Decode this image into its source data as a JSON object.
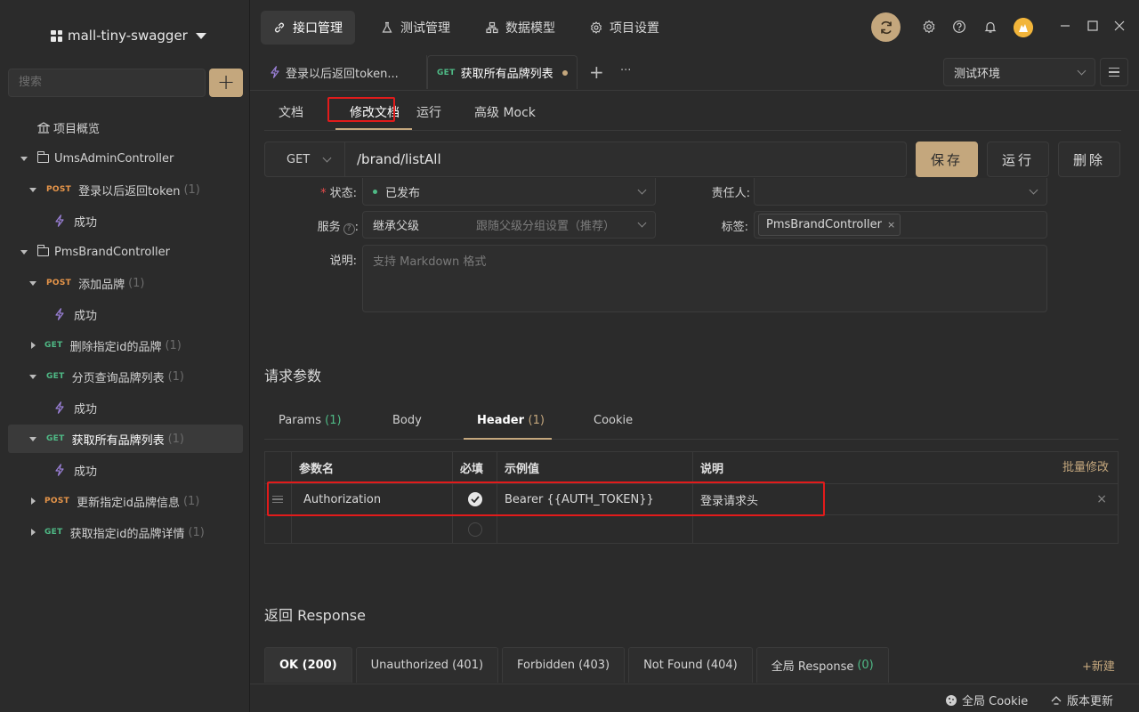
{
  "sidebar": {
    "project_name": "mall-tiny-swagger",
    "search_placeholder": "搜索",
    "add_label": "+",
    "items": [
      {
        "label": "项目概览"
      },
      {
        "label": "UmsAdminController"
      },
      {
        "method": "POST",
        "label": "登录以后返回token",
        "count": "(1)"
      },
      {
        "label": "成功"
      },
      {
        "label": "PmsBrandController"
      },
      {
        "method": "POST",
        "label": "添加品牌",
        "count": "(1)"
      },
      {
        "label": "成功"
      },
      {
        "method": "GET",
        "label": "删除指定id的品牌",
        "count": "(1)"
      },
      {
        "method": "GET",
        "label": "分页查询品牌列表",
        "count": "(1)"
      },
      {
        "label": "成功"
      },
      {
        "method": "GET",
        "label": "获取所有品牌列表",
        "count": "(1)"
      },
      {
        "label": "成功"
      },
      {
        "method": "POST",
        "label": "更新指定id品牌信息",
        "count": "(1)"
      },
      {
        "method": "GET",
        "label": "获取指定id的品牌详情",
        "count": "(1)"
      }
    ]
  },
  "topnav": {
    "items": [
      "接口管理",
      "测试管理",
      "数据模型",
      "项目设置"
    ]
  },
  "tabs": {
    "tab1": "登录以后返回token...",
    "tab2_method": "GET",
    "tab2": "获取所有品牌列表",
    "plus": "+",
    "more": "···",
    "env": "测试环境"
  },
  "subtabs": [
    "文档",
    "修改文档",
    "运行",
    "高级 Mock"
  ],
  "request": {
    "method": "GET",
    "url": "/brand/listAll",
    "save": "保存",
    "run": "运行",
    "delete": "删除"
  },
  "form": {
    "status_label": "状态:",
    "status_value": "已发布",
    "owner_label": "责任人:",
    "service_label": "服务",
    "service_value": "继承父级",
    "service_hint": "跟随父级分组设置（推荐）",
    "tags_label": "标签:",
    "tag_value": "PmsBrandController",
    "desc_label": "说明:",
    "desc_placeholder": "支持 Markdown 格式"
  },
  "params": {
    "title": "请求参数",
    "tabs": [
      {
        "label": "Params",
        "count": "(1)"
      },
      {
        "label": "Body",
        "count": ""
      },
      {
        "label": "Header",
        "count": "(1)"
      },
      {
        "label": "Cookie",
        "count": ""
      }
    ],
    "headers": {
      "name": "参数名",
      "required": "必填",
      "example": "示例值",
      "desc": "说明"
    },
    "batch_edit": "批量修改",
    "rows": [
      {
        "name": "Authorization",
        "required": true,
        "example": "Bearer {{AUTH_TOKEN}}",
        "desc": "登录请求头"
      }
    ]
  },
  "response": {
    "title": "返回 Response",
    "tabs": [
      {
        "label": "OK (200)",
        "count": ""
      },
      {
        "label": "Unauthorized (401)",
        "count": ""
      },
      {
        "label": "Forbidden (403)",
        "count": ""
      },
      {
        "label": "Not Found (404)",
        "count": ""
      },
      {
        "label": "全局 Response",
        "count": "(0)"
      }
    ],
    "new": "+新建"
  },
  "footer": {
    "cookie": "全局 Cookie",
    "update": "版本更新"
  },
  "colors": {
    "accent": "#c4a77d",
    "post": "#e8964a",
    "get": "#4fba86",
    "highlight_box": "#e21b1b"
  }
}
